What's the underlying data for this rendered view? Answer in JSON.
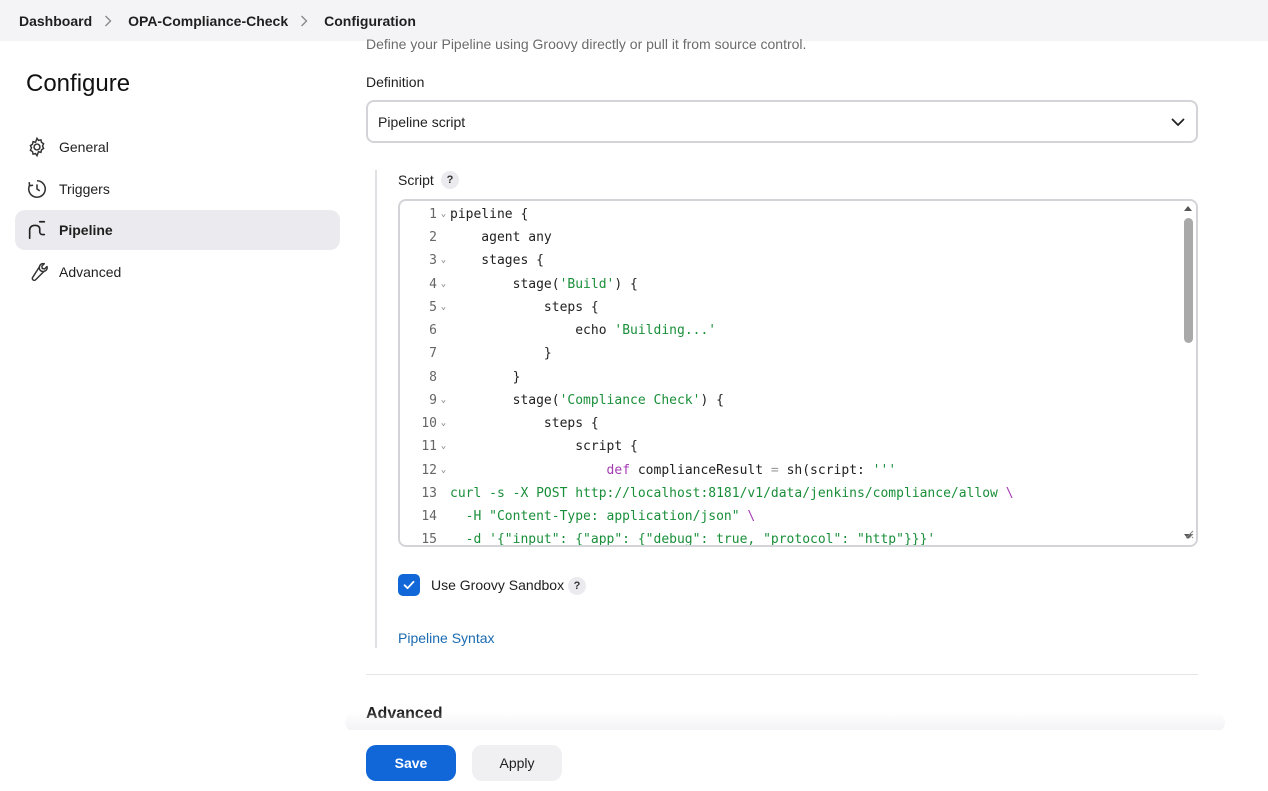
{
  "breadcrumb": {
    "items": [
      "Dashboard",
      "OPA-Compliance-Check",
      "Configuration"
    ]
  },
  "sidebar": {
    "title": "Configure",
    "items": [
      {
        "label": "General",
        "icon": "gear-icon"
      },
      {
        "label": "Triggers",
        "icon": "clock-icon"
      },
      {
        "label": "Pipeline",
        "icon": "pipeline-icon",
        "active": true
      },
      {
        "label": "Advanced",
        "icon": "wrench-icon"
      }
    ]
  },
  "pipeline": {
    "description": "Define your Pipeline using Groovy directly or pull it from source control.",
    "definition_label": "Definition",
    "definition_value": "Pipeline script",
    "script_label": "Script",
    "help": "?",
    "code_lines": [
      "pipeline {",
      "    agent any",
      "    stages {",
      "        stage('Build') {",
      "            steps {",
      "                echo 'Building...'",
      "            }",
      "        }",
      "        stage('Compliance Check') {",
      "            steps {",
      "                script {",
      "                    def complianceResult = sh(script: '''",
      "curl -s -X POST http://localhost:8181/v1/data/jenkins/compliance/allow \\",
      "  -H \"Content-Type: application/json\" \\",
      "  -d '{\"input\": {\"app\": {\"debug\": true, \"protocol\": \"http\"}}}'"
    ],
    "sandbox_label": "Use Groovy Sandbox",
    "sandbox_checked": true,
    "syntax_link": "Pipeline Syntax"
  },
  "advanced_heading": "Advanced",
  "buttons": {
    "save": "Save",
    "apply": "Apply"
  },
  "colors": {
    "accent": "#1167d8",
    "link": "#1a6ab0",
    "string": "#1a8f3a",
    "keyword": "#a43bb3"
  }
}
